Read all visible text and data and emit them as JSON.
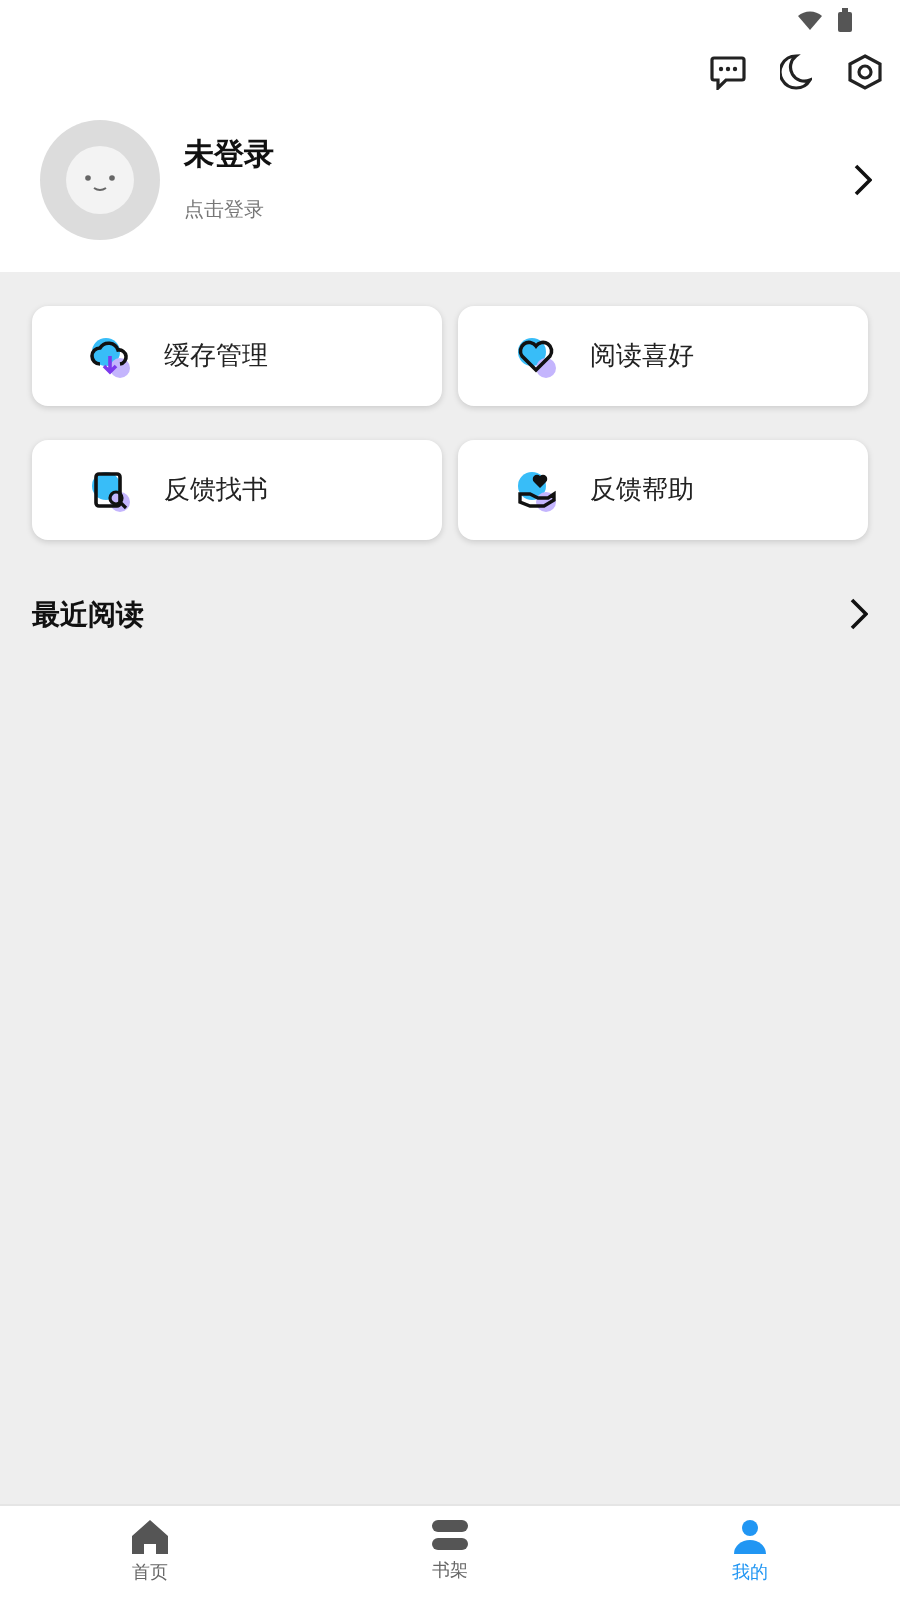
{
  "profile": {
    "name": "未登录",
    "hint": "点击登录"
  },
  "shortcuts": [
    {
      "label": "缓存管理",
      "kind": "cache"
    },
    {
      "label": "阅读喜好",
      "kind": "preference"
    },
    {
      "label": "反馈找书",
      "kind": "find"
    },
    {
      "label": "反馈帮助",
      "kind": "help"
    }
  ],
  "recent": {
    "title": "最近阅读"
  },
  "nav": [
    {
      "label": "首页",
      "kind": "home",
      "selected": false
    },
    {
      "label": "书架",
      "kind": "shelf",
      "selected": false
    },
    {
      "label": "我的",
      "kind": "me",
      "selected": true
    }
  ]
}
